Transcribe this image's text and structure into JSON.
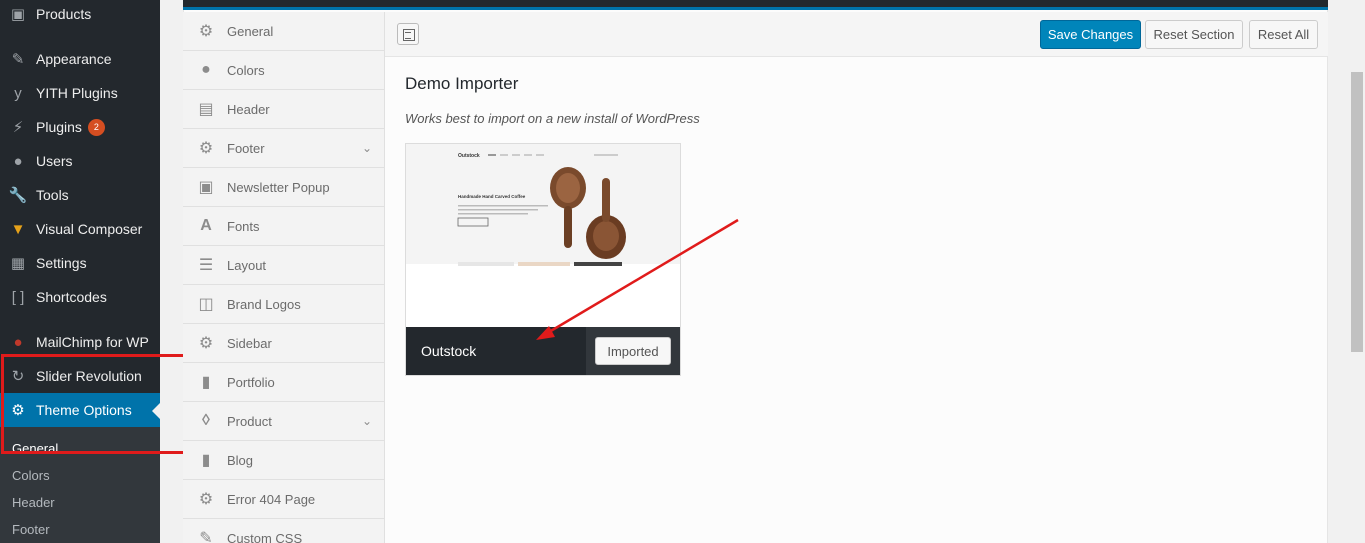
{
  "sidebar": {
    "items": [
      {
        "label": "Products",
        "icon": "cube-icon"
      },
      {
        "label": "Appearance",
        "icon": "brush-icon"
      },
      {
        "label": "YITH Plugins",
        "icon": "yith-icon"
      },
      {
        "label": "Plugins",
        "icon": "plug-icon",
        "badge": "2"
      },
      {
        "label": "Users",
        "icon": "user-icon"
      },
      {
        "label": "Tools",
        "icon": "wrench-icon"
      },
      {
        "label": "Visual Composer",
        "icon": "vc-icon"
      },
      {
        "label": "Settings",
        "icon": "settings-icon"
      },
      {
        "label": "Shortcodes",
        "icon": "brackets-icon"
      },
      {
        "label": "MailChimp for WP",
        "icon": "mailchimp-icon"
      },
      {
        "label": "Slider Revolution",
        "icon": "refresh-icon"
      },
      {
        "label": "Theme Options",
        "icon": "gear-icon"
      }
    ],
    "submenu": [
      "General",
      "Colors",
      "Header",
      "Footer"
    ]
  },
  "options_nav": {
    "items": [
      {
        "label": "General",
        "icon": "gear-icon"
      },
      {
        "label": "Colors",
        "icon": "drop-icon"
      },
      {
        "label": "Header",
        "icon": "header-icon"
      },
      {
        "label": "Footer",
        "icon": "gear-icon"
      },
      {
        "label": "Newsletter Popup",
        "icon": "popup-icon"
      },
      {
        "label": "Fonts",
        "icon": "font-icon"
      },
      {
        "label": "Layout",
        "icon": "layout-icon"
      },
      {
        "label": "Brand Logos",
        "icon": "briefcase-icon"
      },
      {
        "label": "Sidebar",
        "icon": "gear-icon"
      },
      {
        "label": "Portfolio",
        "icon": "bookmark-icon"
      },
      {
        "label": "Product",
        "icon": "tags-icon"
      },
      {
        "label": "Blog",
        "icon": "document-icon"
      },
      {
        "label": "Error 404 Page",
        "icon": "gear-icon"
      },
      {
        "label": "Custom CSS",
        "icon": "pencil-icon"
      }
    ]
  },
  "toolbar": {
    "save_label": "Save Changes",
    "reset_section_label": "Reset Section",
    "reset_all_label": "Reset All"
  },
  "section": {
    "title": "Demo Importer",
    "description": "Works best to import on a new install of WordPress"
  },
  "demo": {
    "name": "Outstock",
    "button_label": "Imported",
    "preview_logo": "Outstock",
    "preview_heading": "Handmade Hand Carved Coffee"
  },
  "colors": {
    "sidebar_bg": "#23282d",
    "accent": "#0073aa",
    "primary_button": "#0085ba",
    "highlight": "#e01b1b"
  }
}
